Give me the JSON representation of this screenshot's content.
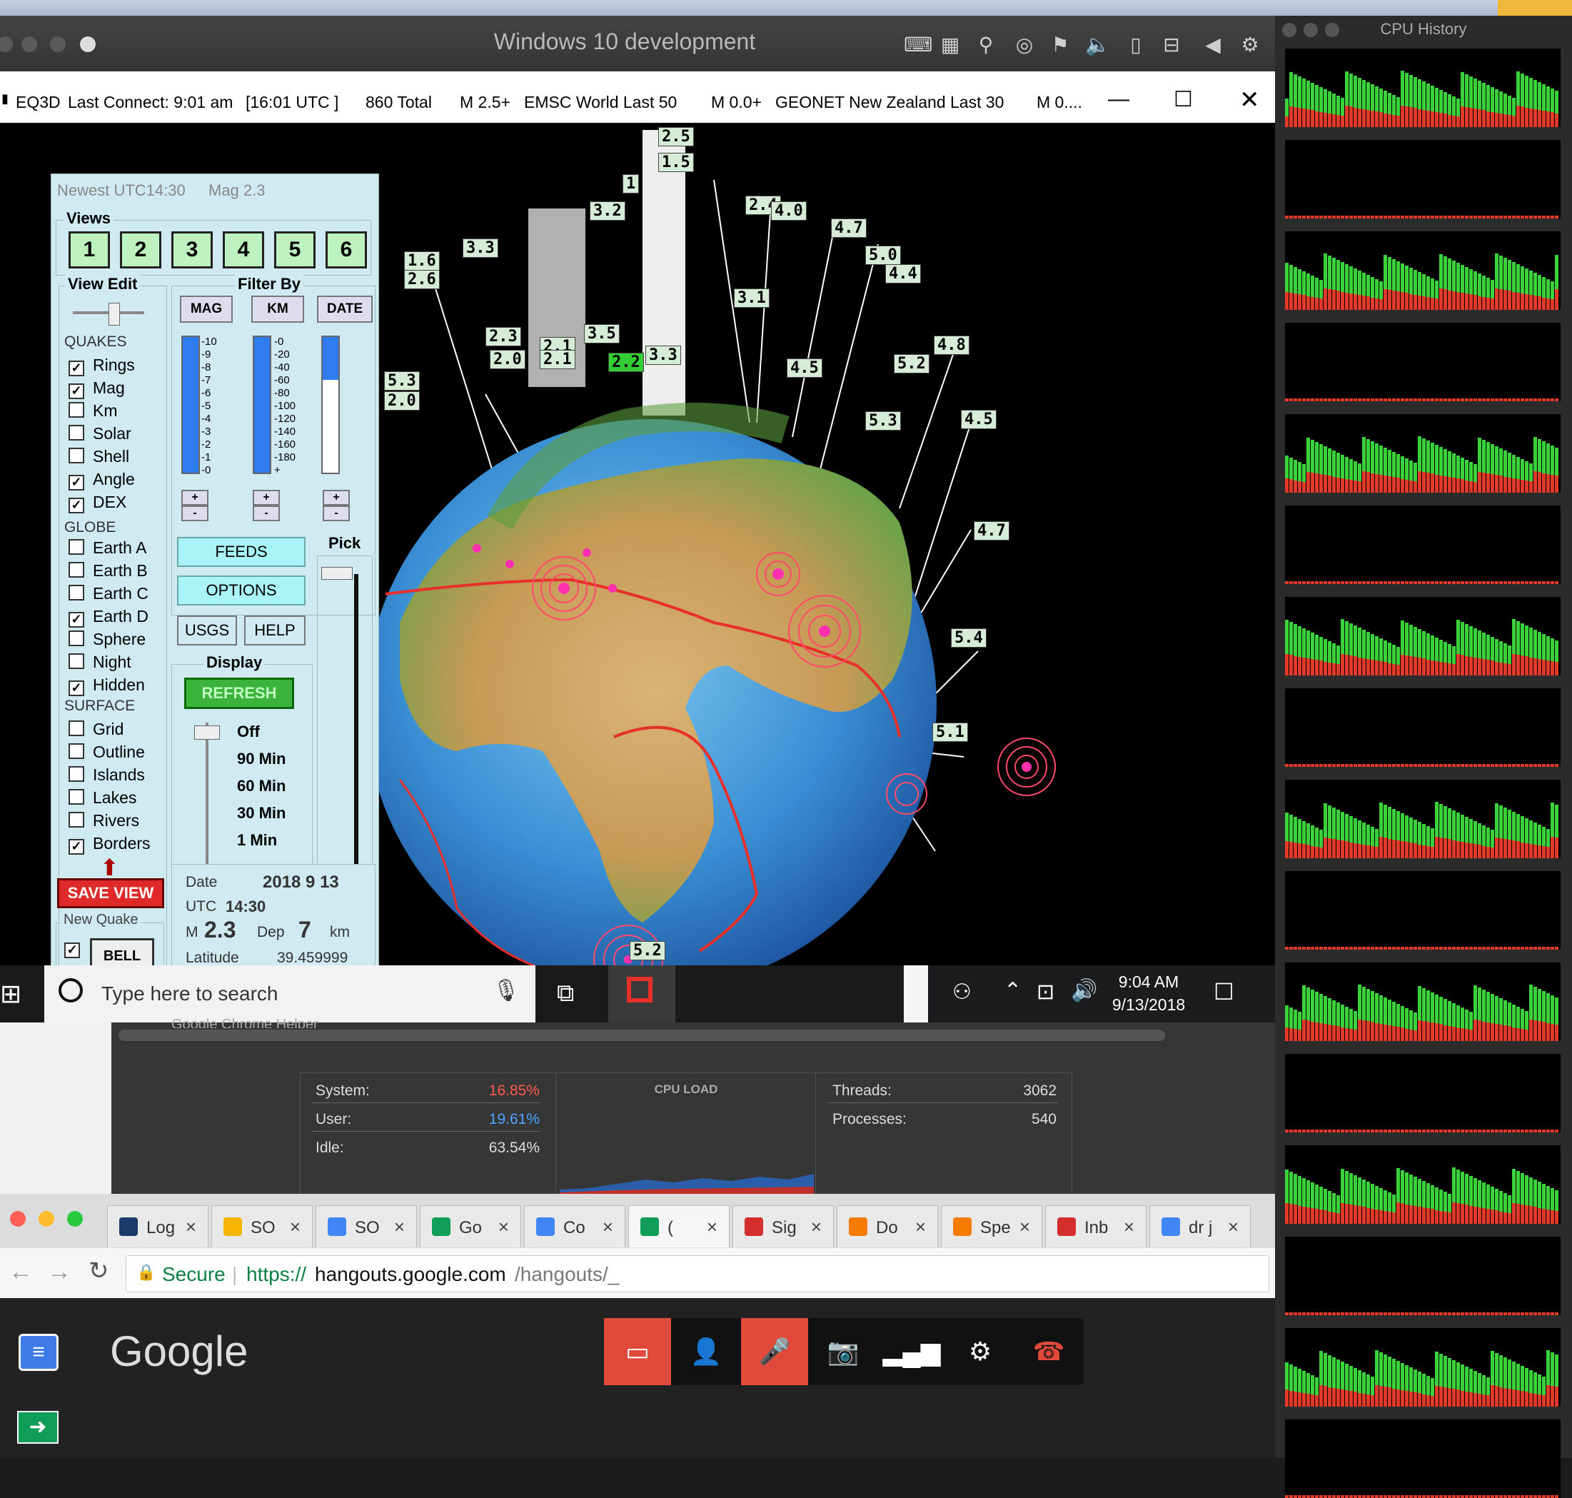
{
  "vm_window": {
    "title": "Windows 10 development"
  },
  "eq3d": {
    "titlebar": {
      "app": "EQ3D",
      "last_connect": "Last Connect: 9:01 am",
      "utc": "[16:01 UTC ]",
      "total": "860  Total",
      "feed1_mag": "M 2.5+",
      "feed1_name": "EMSC World Last 50",
      "feed2_mag": "M 0.0+",
      "feed2_name": "GEONET New Zealand Last 30",
      "feed3": "M 0...."
    },
    "panel": {
      "header_newest": "Newest UTC14:30",
      "header_mag": "Mag 2.3",
      "views_title": "Views",
      "views": [
        "1",
        "2",
        "3",
        "4",
        "5",
        "6"
      ],
      "view_edit_title": "View Edit",
      "filter_title": "Filter By",
      "filter_buttons": [
        "MAG",
        "KM",
        "DATE"
      ],
      "mag_ticks": [
        "-10",
        "-9",
        "-8",
        "-7",
        "-6",
        "-5",
        "-4",
        "-3",
        "-2",
        "-1",
        "-0"
      ],
      "km_ticks": [
        "-0",
        "-20",
        "-40",
        "-60",
        "-80",
        "-100",
        "-120",
        "-140",
        "-160",
        "-180",
        "+"
      ],
      "quakes_label": "QUAKES",
      "quakes": [
        {
          "label": "Rings",
          "checked": true
        },
        {
          "label": "Mag",
          "checked": true
        },
        {
          "label": "Km",
          "checked": false
        },
        {
          "label": "Solar",
          "checked": false
        },
        {
          "label": "Shell",
          "checked": false
        },
        {
          "label": "Angle",
          "checked": true
        },
        {
          "label": "DEX",
          "checked": true
        }
      ],
      "globe_label": "GLOBE",
      "globe": [
        {
          "label": "Earth A",
          "checked": false
        },
        {
          "label": "Earth B",
          "checked": false
        },
        {
          "label": "Earth C",
          "checked": false
        },
        {
          "label": "Earth D",
          "checked": true
        },
        {
          "label": "Sphere",
          "checked": false
        },
        {
          "label": "Night",
          "checked": false
        },
        {
          "label": "Hidden",
          "checked": true
        }
      ],
      "surface_label": "SURFACE",
      "surface": [
        {
          "label": "Grid",
          "checked": false
        },
        {
          "label": "Outline",
          "checked": false
        },
        {
          "label": "Islands",
          "checked": false
        },
        {
          "label": "Lakes",
          "checked": false
        },
        {
          "label": "Rivers",
          "checked": false
        },
        {
          "label": "Borders",
          "checked": true
        }
      ],
      "feeds_btn": "FEEDS",
      "options_btn": "OPTIONS",
      "usgs_btn": "USGS",
      "help_btn": "HELP",
      "pick_label": "Pick",
      "display_title": "Display",
      "refresh_btn": "REFRESH",
      "display_options": [
        "Off",
        "90 Min",
        "60 Min",
        "30 Min",
        "1 Min"
      ],
      "save_view": "SAVE VIEW",
      "new_quake_title": "New Quake",
      "bell": "BELL",
      "info": {
        "date_label": "Date",
        "date_value": "2018  9  13",
        "utc_label": "UTC",
        "utc_value": "14:30",
        "m_label": "M",
        "m_value": "2.3",
        "dep_label": "Dep",
        "dep_value": "7",
        "km_label": "km",
        "lat_label": "Latitude",
        "lat_value": "39.459999"
      }
    },
    "quake_labels": [
      "2.5",
      "1.5",
      "1",
      "2.4",
      "4.0",
      "4.7",
      "5.0",
      "4.4",
      "1.6",
      "2.6",
      "3.3",
      "3.1",
      "2.1",
      "3.2",
      "3.5",
      "2.2",
      "3.3",
      "2.3",
      "2.1",
      "2.0",
      "4.5",
      "4.8",
      "5.2",
      "5.3",
      "4.5",
      "5.3",
      "2.0",
      "4.7",
      "5.4",
      "5.1",
      "5.2"
    ]
  },
  "taskbar": {
    "search_placeholder": "Type here to search",
    "time": "9:04 AM",
    "date": "9/13/2018"
  },
  "activity_monitor": {
    "truncated_row": "Google Chrome Helper",
    "system_label": "System:",
    "system_value": "16.85%",
    "user_label": "User:",
    "user_value": "19.61%",
    "idle_label": "Idle:",
    "idle_value": "63.54%",
    "cpu_load_title": "CPU LOAD",
    "threads_label": "Threads:",
    "threads_value": "3062",
    "processes_label": "Processes:",
    "processes_value": "540"
  },
  "cpu_history": {
    "title": "CPU History"
  },
  "chrome": {
    "tabs": [
      {
        "label": "Log",
        "color": "#1a3a6a"
      },
      {
        "label": "SO",
        "color": "#f4b400"
      },
      {
        "label": "SO",
        "color": "#4285f4"
      },
      {
        "label": "Go",
        "color": "#0f9d58"
      },
      {
        "label": "Co",
        "color": "#4285f4"
      },
      {
        "label": "(",
        "color": "#0f9d58"
      },
      {
        "label": "Sig",
        "color": "#d32f2f"
      },
      {
        "label": "Do",
        "color": "#f57c00"
      },
      {
        "label": "Spe",
        "color": "#f57c00"
      },
      {
        "label": "Inb",
        "color": "#d32f2f"
      },
      {
        "label": "dr j",
        "color": "#4285f4"
      }
    ],
    "secure_label": "Secure",
    "url_scheme": "https://",
    "url_host": "hangouts.google.com",
    "url_path": "/hangouts/_"
  },
  "hangouts": {
    "logo": "Google"
  },
  "colors": {
    "accent_red": "#e04a3a",
    "system_red": "#ff5a4e",
    "user_blue": "#4aa3ff",
    "cpu_green": "#3bd13b",
    "cpu_red": "#e23a2a"
  }
}
